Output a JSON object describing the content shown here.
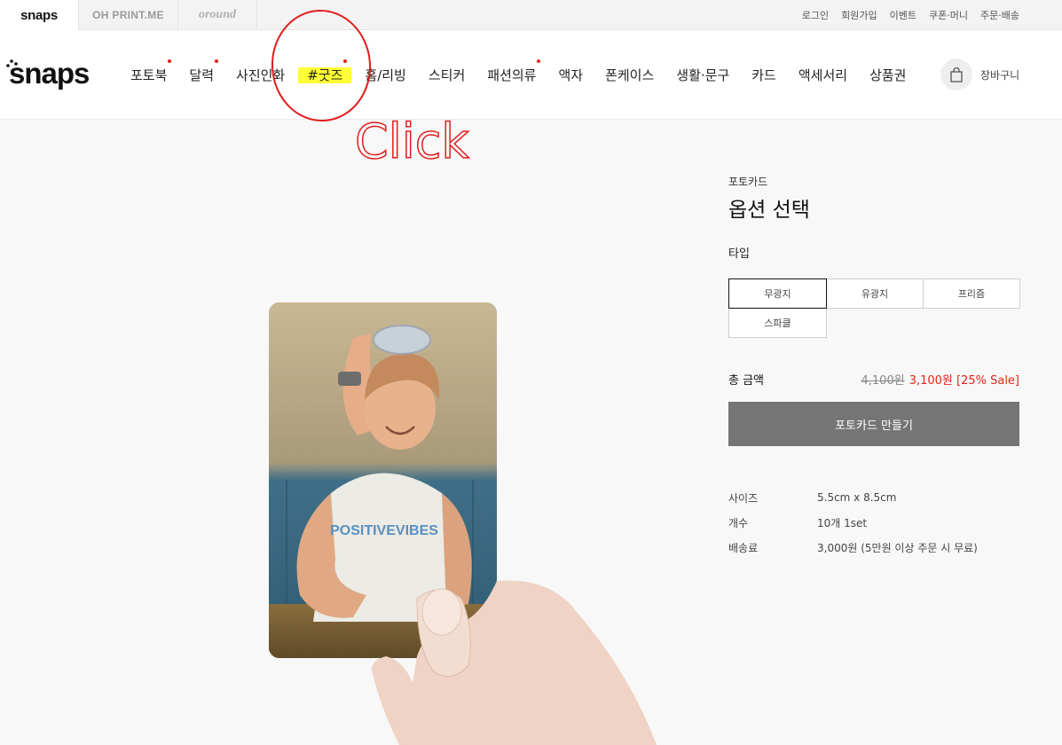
{
  "brands": {
    "snaps": "snaps",
    "ohprint": "OH PRINT.ME",
    "oround": "oround"
  },
  "utils": [
    "로그인",
    "회원가입",
    "이벤트",
    "쿠폰·머니",
    "주문·배송"
  ],
  "logo": "snaps",
  "nav": [
    {
      "label": "포토북",
      "dot": true
    },
    {
      "label": "달력",
      "dot": true
    },
    {
      "label": "사진인화",
      "dot": false
    },
    {
      "label": "#굿즈",
      "dot": true
    },
    {
      "label": "홈/리빙",
      "dot": false
    },
    {
      "label": "스티커",
      "dot": false
    },
    {
      "label": "패션의류",
      "dot": true
    },
    {
      "label": "액자",
      "dot": false
    },
    {
      "label": "폰케이스",
      "dot": false
    },
    {
      "label": "생활·문구",
      "dot": false
    },
    {
      "label": "카드",
      "dot": false
    },
    {
      "label": "액세서리",
      "dot": false
    },
    {
      "label": "상품권",
      "dot": false
    }
  ],
  "cart": {
    "label": "장바구니",
    "icon": "shopping-bag-icon"
  },
  "annotation": {
    "text": "Click",
    "color": "#e11d1d"
  },
  "product": {
    "category": "포토카드",
    "title": "옵션 선택",
    "type_label": "타입",
    "options": [
      "무광지",
      "유광지",
      "프리즘",
      "스파클"
    ],
    "selected_option": "무광지",
    "total_label": "총 금액",
    "original_price": "4,100원",
    "sale_price": "3,100원 [25% Sale]",
    "button_label": "포토카드 만들기",
    "specs": [
      {
        "key": "사이즈",
        "value": "5.5cm x 8.5cm"
      },
      {
        "key": "개수",
        "value": "10개 1set"
      },
      {
        "key": "배송료",
        "value": "3,000원 (5만원 이상 주문 시 무료)"
      }
    ],
    "card_print_text": "POSITIVEVIBES"
  },
  "colors": {
    "accent_red": "#e2231a",
    "highlight": "#ffff33",
    "button_gray": "#757575"
  }
}
